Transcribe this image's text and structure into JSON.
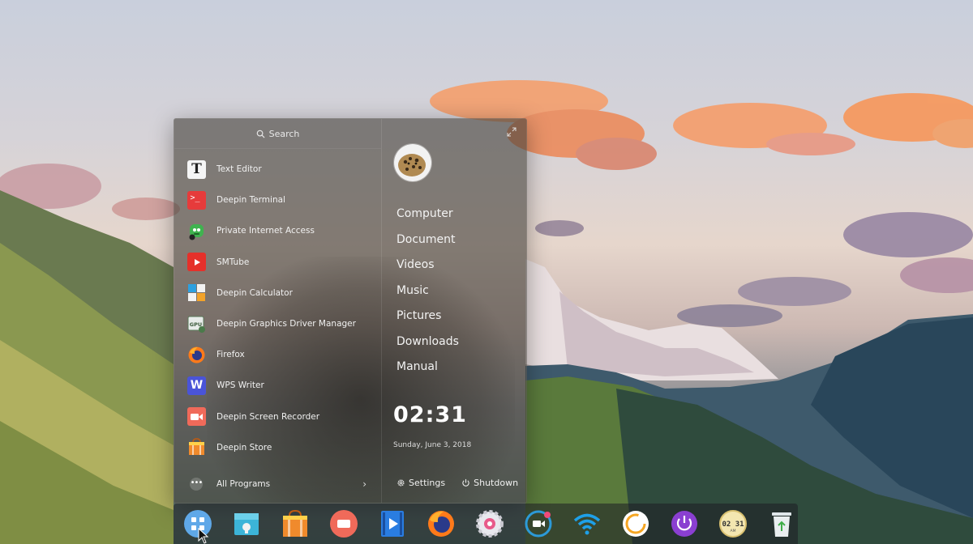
{
  "launcher": {
    "search_placeholder": "Search",
    "apps": [
      {
        "label": "Text Editor",
        "icon": "text-editor-icon"
      },
      {
        "label": "Deepin Terminal",
        "icon": "terminal-icon"
      },
      {
        "label": "Private Internet Access",
        "icon": "pia-icon"
      },
      {
        "label": "SMTube",
        "icon": "smtube-icon"
      },
      {
        "label": "Deepin Calculator",
        "icon": "calculator-icon"
      },
      {
        "label": "Deepin Graphics Driver Manager",
        "icon": "gpu-icon"
      },
      {
        "label": "Firefox",
        "icon": "firefox-icon"
      },
      {
        "label": "WPS Writer",
        "icon": "wps-writer-icon"
      },
      {
        "label": "Deepin Screen Recorder",
        "icon": "screen-recorder-icon"
      },
      {
        "label": "Deepin Store",
        "icon": "store-icon"
      }
    ],
    "all_programs_label": "All Programs",
    "places": [
      "Computer",
      "Document",
      "Videos",
      "Music",
      "Pictures",
      "Downloads",
      "Manual"
    ],
    "time": "02:31",
    "date": "Sunday, June 3, 2018",
    "settings_label": "Settings",
    "shutdown_label": "Shutdown"
  },
  "dock": {
    "items": [
      {
        "name": "launcher-icon",
        "color": "#5fa8e8"
      },
      {
        "name": "file-manager-icon",
        "color": "#3cb4d8"
      },
      {
        "name": "store-icon",
        "color": "#f08a2c"
      },
      {
        "name": "screen-recorder-icon",
        "color": "#f06a5a"
      },
      {
        "name": "video-player-icon",
        "color": "#2a7de1"
      },
      {
        "name": "firefox-icon",
        "color": "#ff7a1a"
      },
      {
        "name": "settings-icon",
        "color": "#e85a8a"
      },
      {
        "name": "camera-icon",
        "color": "#2c9ad8"
      },
      {
        "name": "wifi-icon",
        "color": "#1ea0e8"
      },
      {
        "name": "power-ring-icon",
        "color": "#f5a623"
      },
      {
        "name": "shutdown-icon",
        "color": "#8a3fd1"
      },
      {
        "name": "clock-icon",
        "color": "#f3e6b0"
      },
      {
        "name": "trash-icon",
        "color": "#e9eef0"
      }
    ],
    "clock_face": "02 31",
    "clock_ampm": "AM"
  }
}
